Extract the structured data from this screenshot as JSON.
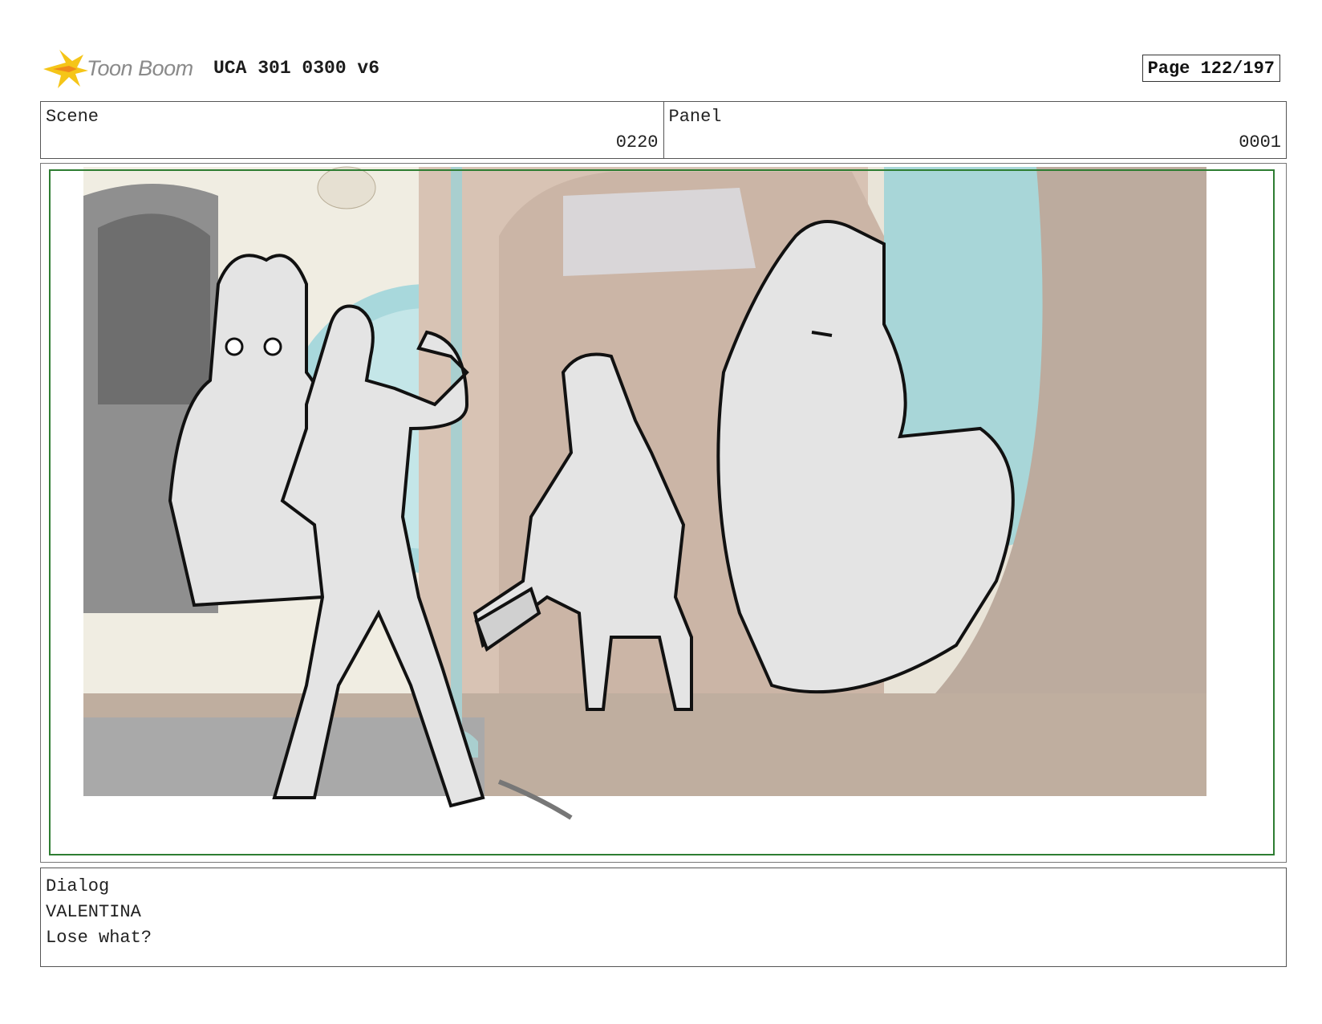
{
  "header": {
    "logo_text": "Toon Boom",
    "doc_title": "UCA 301 0300 v6",
    "page": "Page 122/197"
  },
  "scene": {
    "label": "Scene",
    "value": "0220"
  },
  "panel": {
    "label": "Panel",
    "value": "0001"
  },
  "dialog": {
    "label": "Dialog",
    "character": "VALENTINA",
    "line": "Lose what?"
  },
  "colors": {
    "safe_frame": "#2e7d32",
    "logo_star": "#f5c518"
  }
}
